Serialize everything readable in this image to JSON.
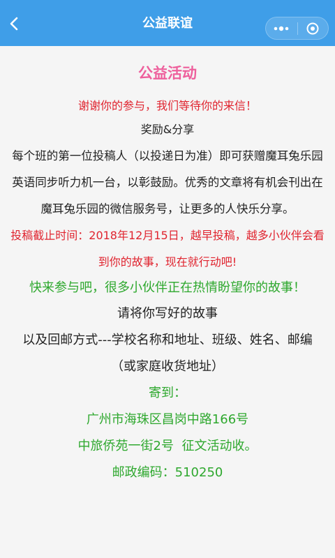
{
  "nav": {
    "title": "公益联谊",
    "back_icon": "chevron-left-icon",
    "more_icon": "more-dots-icon",
    "close_icon": "target-close-icon"
  },
  "colors": {
    "navbar": "#3f9ee8",
    "heading": "#ee5f9c",
    "red_text": "#e0242f",
    "green_text": "#2ea82e",
    "body_text": "#222222",
    "background": "#f5f5f5"
  },
  "content": {
    "heading": "公益活动",
    "thanks": "谢谢你的参与，我们等待你的来信！",
    "reward_title": "奖励&分享",
    "reward_lines": [
      "每个班的第一位投稿人（以投递日为准）即可获赠魔耳兔乐园",
      "英语同步听力机一台，以彰鼓励。优秀的文章将有机会刊出在",
      "魔耳兔乐园的微信服务号，让更多的人快乐分享。"
    ],
    "deadline_lines": [
      "投稿截止时间：2018年12月15日，越早投稿，越多小伙伴会看",
      "到你的故事，现在就行动吧!"
    ],
    "join": "快来参与吧，很多小伙伴正在热情盼望你的故事！",
    "submit": "请将你写好的故事",
    "mail_method": "以及回邮方式---学校名称和地址、班级、姓名、邮编",
    "mail_method_2": "（或家庭收货地址）",
    "send_to": "寄到：",
    "address_1": "广州市海珠区昌岗中路166号",
    "address_2": "中旅侨苑一街2号  征文活动收。",
    "postcode": "邮政编码：510250"
  }
}
